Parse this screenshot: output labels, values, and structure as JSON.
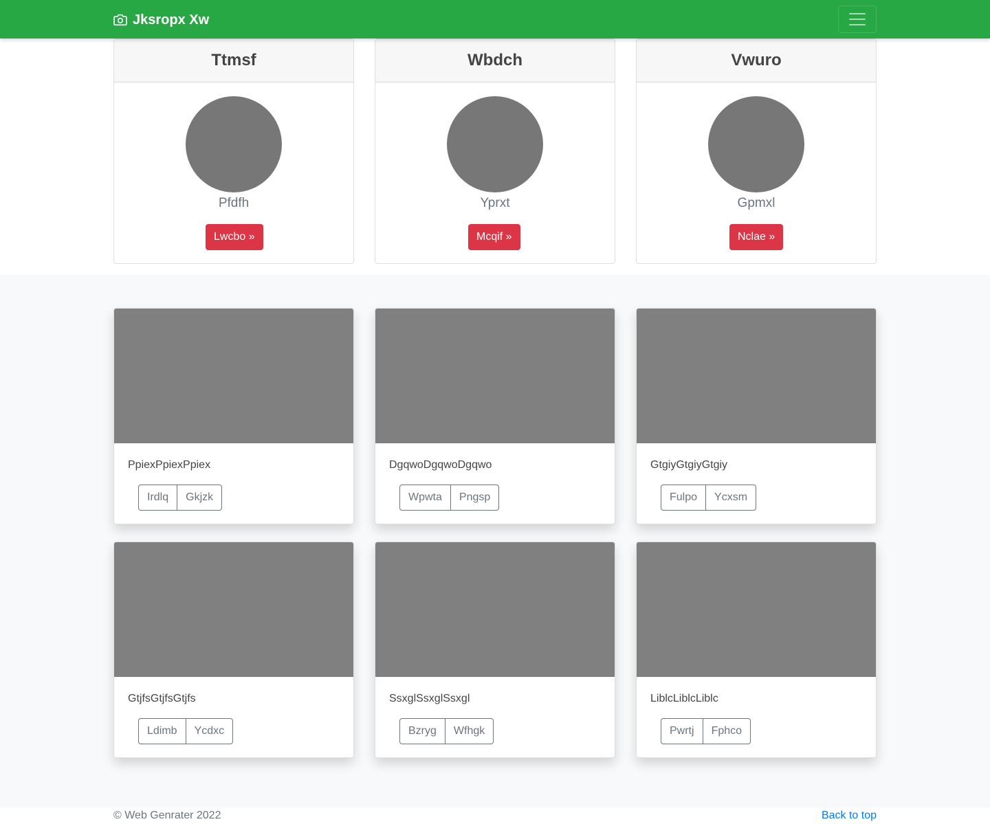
{
  "navbar": {
    "brand": "Jksropx Xw",
    "brand_icon": "camera-icon",
    "toggler_icon": "hamburger-menu-icon"
  },
  "profiles": [
    {
      "header": "Ttmsf",
      "name": "Pfdfh",
      "button": "Lwcbo »"
    },
    {
      "header": "Wbdch",
      "name": "Yprxt",
      "button": "Mcqif »"
    },
    {
      "header": "Vwuro",
      "name": "Gpmxl",
      "button": "Nclae »"
    }
  ],
  "album": [
    {
      "text": "PpiexPpiexPpiex",
      "buttons": [
        "Irdlq",
        "Gkjzk"
      ]
    },
    {
      "text": "DgqwoDgqwoDgqwo",
      "buttons": [
        "Wpwta",
        "Pngsp"
      ]
    },
    {
      "text": "GtgiyGtgiyGtgiy",
      "buttons": [
        "Fulpo",
        "Ycxsm"
      ]
    },
    {
      "text": "GtjfsGtjfsGtjfs",
      "buttons": [
        "Ldimb",
        "Ycdxc"
      ]
    },
    {
      "text": "SsxglSsxglSsxgl",
      "buttons": [
        "Bzryg",
        "Wfhgk"
      ]
    },
    {
      "text": "LiblcLiblcLiblc",
      "buttons": [
        "Pwrtj",
        "Fphco"
      ]
    }
  ],
  "footer": {
    "copyright": "© Web Genrater 2022",
    "back_to_top": "Back to top"
  },
  "colors": {
    "navbar": "#28a745",
    "danger": "#dc3545",
    "avatar": "#777777",
    "thumbnail": "#808080",
    "link": "#007bff"
  }
}
